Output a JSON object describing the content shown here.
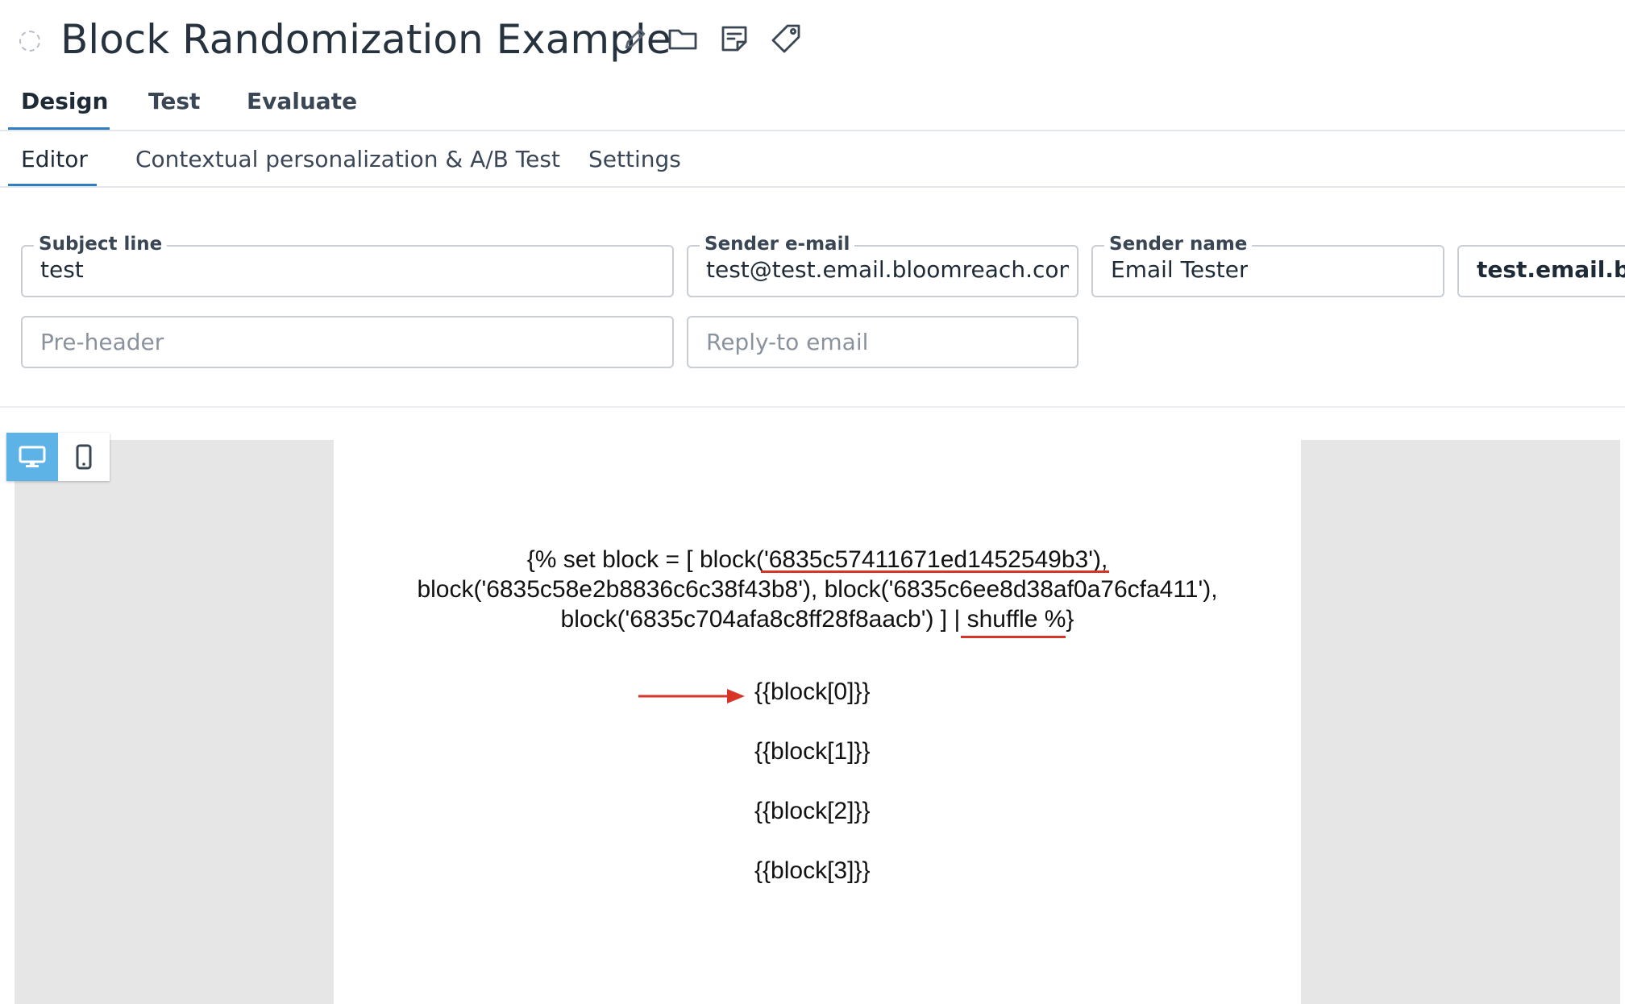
{
  "header": {
    "title": "Block Randomization Example",
    "icons": [
      "edit-icon",
      "folder-icon",
      "note-icon",
      "tag-icon"
    ]
  },
  "tabs": [
    {
      "label": "Design",
      "active": true
    },
    {
      "label": "Test",
      "active": false
    },
    {
      "label": "Evaluate",
      "active": false
    }
  ],
  "subtabs": [
    {
      "label": "Editor",
      "active": true
    },
    {
      "label": "Contextual personalization & A/B Test",
      "active": false
    },
    {
      "label": "Settings",
      "active": false
    }
  ],
  "fields": {
    "subject_line": {
      "label": "Subject line",
      "value": "test"
    },
    "sender_email": {
      "label": "Sender e-mail",
      "value": "test@test.email.bloomreach.com"
    },
    "sender_name": {
      "label": "Sender name",
      "value": "Email Tester"
    },
    "domain": {
      "value": "test.email.bloomreach.com"
    },
    "pre_header": {
      "placeholder": "Pre-header"
    },
    "reply_to": {
      "placeholder": "Reply-to email"
    }
  },
  "preview": {
    "devices": [
      "desktop-icon",
      "mobile-icon"
    ],
    "active_device": "desktop",
    "code_lines": [
      "{% set block = [ block('6835c57411671ed1452549b3'),",
      "block('6835c58e2b8836c6c38f43b8'), block('6835c6ee8d38af0a76cfa411'),",
      "block('6835c704afa8c8ff28f8aacb') ] | shuffle %}"
    ],
    "blocks": [
      "{{block[0]}}",
      "{{block[1]}}",
      "{{block[2]}}",
      "{{block[3]}}"
    ]
  },
  "colors": {
    "accent": "#2f7fc0",
    "toggle_active": "#5eb3e6",
    "annotation_red": "#d8352a"
  }
}
